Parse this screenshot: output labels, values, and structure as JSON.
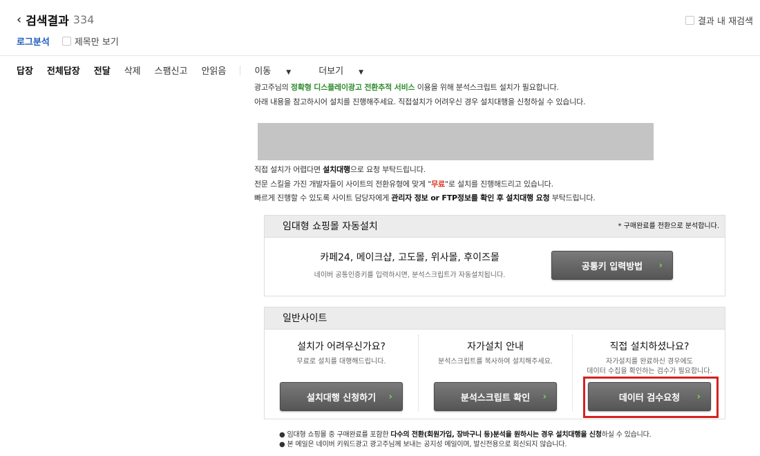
{
  "header": {
    "back_label": "검색결과",
    "count": "334",
    "research_label": "결과 내 재검색",
    "log_analysis": "로그분석",
    "title_only": "제목만 보기"
  },
  "toolbar": {
    "reply": "답장",
    "reply_all": "전체답장",
    "forward": "전달",
    "delete": "삭제",
    "spam": "스팸신고",
    "unread": "안읽음",
    "move": "이동",
    "more": "더보기"
  },
  "body": {
    "line0_pre": "광고주님의 ",
    "line0_green": "정확형 디스플레이광고 전환추적 서비스",
    "line0_post": " 이용을 위해 분석스크립트 설치가 필요합니다.",
    "line1": "아래 내용을 참고하시어 설치를 진행해주세요. 직접설치가 어려우신 경우 설치대행을 신청하실 수 있습니다.",
    "line2_pre": "직접 설치가 어렵다면 ",
    "line2_bold": "설치대행",
    "line2_post": "으로 요청 부탁드립니다.",
    "line3_pre": "전문 스킬을 가진 개발자들이 사이트의 전환유형에 맞게 \"",
    "line3_red": "무료",
    "line3_post": "\"로 설치를 진행해드리고 있습니다.",
    "line4_pre": "빠르게 진행할 수 있도록 사이트 담당자에게 ",
    "line4_bold": "관리자 정보 or FTP정보를 확인 후 설치대행 요청",
    "line4_post": " 부탁드립니다."
  },
  "panel1": {
    "title": "임대형 쇼핑몰 자동설치",
    "note": "* 구매완료를 전환으로 분석합니다.",
    "heading": "카페24, 메이크샵, 고도몰, 위사몰, 후이즈몰",
    "sub": "네이버 공통인증키를 입력하시면, 분석스크립트가 자동설치됩니다.",
    "button": "공통키 입력방법"
  },
  "panel2": {
    "title": "일반사이트",
    "col1": {
      "title": "설치가 어려우신가요?",
      "sub": "무료로 설치를 대행해드립니다.",
      "button": "설치대행 신청하기"
    },
    "col2": {
      "title": "자가설치 안내",
      "sub": "분석스크립트를 복사하여 설치해주세요.",
      "button": "분석스크립트 확인"
    },
    "col3": {
      "title": "직접 설치하셨나요?",
      "sub1": "자가설치를 완료하신 경우에도",
      "sub2": "데이터 수집을 확인하는 검수가 필요합니다.",
      "button": "데이터 검수요청"
    }
  },
  "footer": {
    "note1_pre": "● 임대형 쇼핑몰 중 구매완료를 포함한 ",
    "note1_bold1": "다수의 전환(회원가입, 장바구니 등)분석을 원하시는 경우 설치대행을 신청",
    "note1_post": "하실 수 있습니다.",
    "note2": "● 본 메일은 네이버 키워드광고 광고주님께 보내는 공지성 메일이며, 발신전용으로 회신되지 않습니다."
  },
  "colors": {
    "accent_blue": "#1d5bbf",
    "highlight_red": "#d62020",
    "arrow_green": "#7cd84a"
  }
}
